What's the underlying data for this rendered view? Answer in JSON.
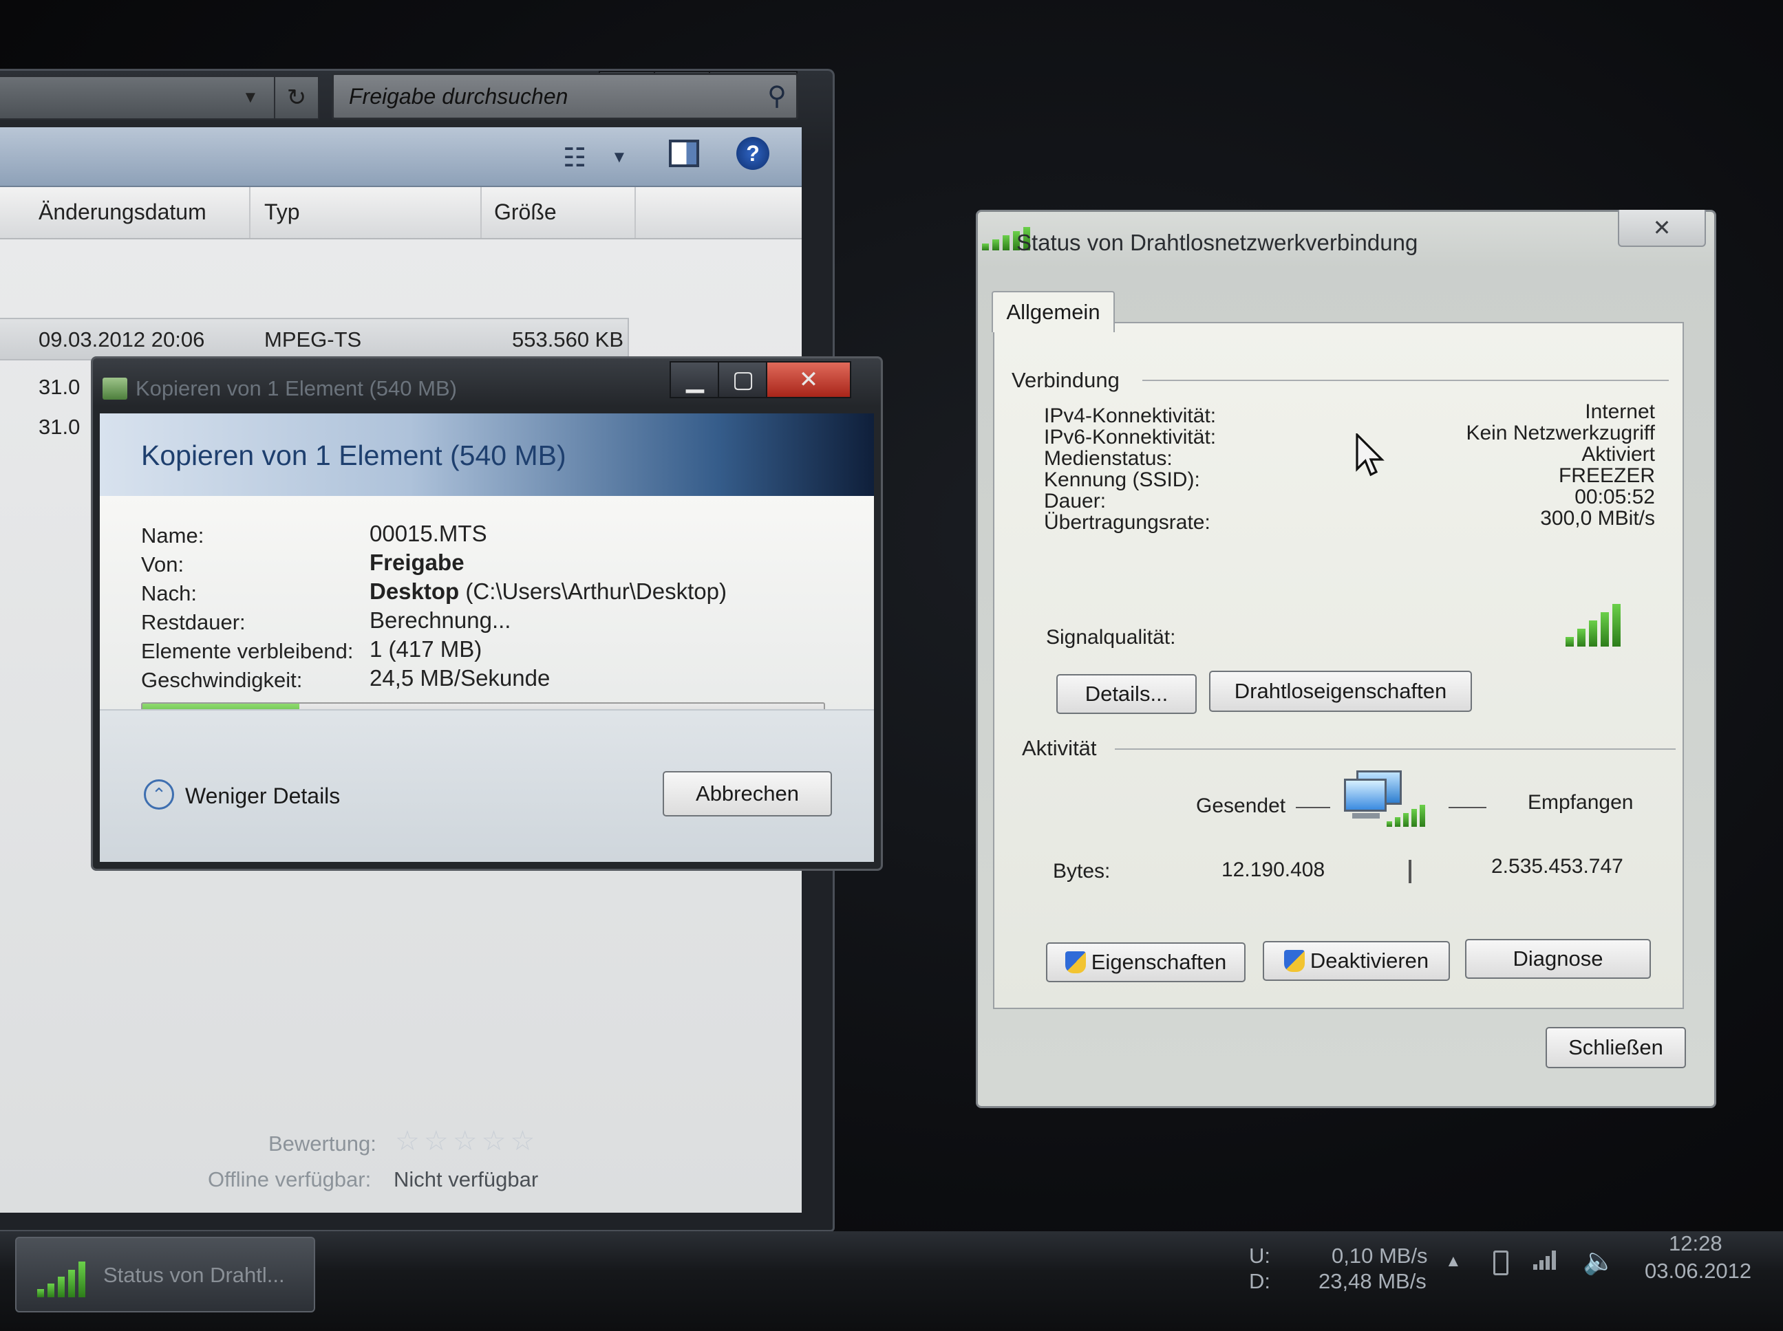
{
  "explorer": {
    "search_placeholder": "Freigabe durchsuchen",
    "columns": [
      "Änderungsdatum",
      "Typ",
      "Größe"
    ],
    "rows": [
      {
        "date": "09.03.2012 20:06",
        "type": "MPEG-TS",
        "size": "553.560 KB"
      },
      {
        "date": "31.0",
        "type": "",
        "size": ""
      },
      {
        "date": "31.0",
        "type": "",
        "size": ""
      }
    ],
    "details": {
      "rating_label": "Bewertung:",
      "rating_stars": 0,
      "offline_label": "Offline verfügbar:",
      "offline_value": "Nicht verfügbar"
    }
  },
  "copy_dialog": {
    "title": "Kopieren von 1 Element (540 MB)",
    "heading": "Kopieren von 1 Element (540 MB)",
    "fields": [
      {
        "label": "Name:",
        "value": "00015.MTS",
        "bold": ""
      },
      {
        "label": "Von:",
        "value": "",
        "bold": "Freigabe"
      },
      {
        "label": "Nach:",
        "value": " (C:\\Users\\Arthur\\Desktop)",
        "bold": "Desktop"
      },
      {
        "label": "Restdauer:",
        "value": "Berechnung...",
        "bold": ""
      },
      {
        "label": "Elemente verbleibend:",
        "value": "1 (417 MB)",
        "bold": ""
      },
      {
        "label": "Geschwindigkeit:",
        "value": "24,5 MB/Sekunde",
        "bold": ""
      }
    ],
    "progress": 0.23,
    "less_details": "Weniger Details",
    "cancel": "Abbrechen"
  },
  "wifi_dialog": {
    "title": "Status von Drahtlosnetzwerkverbindung",
    "tab": "Allgemein",
    "connection_group": "Verbindung",
    "rows": [
      {
        "label": "IPv4-Konnektivität:",
        "value": "Internet"
      },
      {
        "label": "IPv6-Konnektivität:",
        "value": "Kein Netzwerkzugriff"
      },
      {
        "label": "Medienstatus:",
        "value": "Aktiviert"
      },
      {
        "label": "Kennung (SSID):",
        "value": "FREEZER"
      },
      {
        "label": "Dauer:",
        "value": "00:05:52"
      },
      {
        "label": "Übertragungsrate:",
        "value": "300,0 MBit/s"
      }
    ],
    "signal_label": "Signalqualität:",
    "signal_bars": 5,
    "details_btn": "Details...",
    "wireless_props_btn": "Drahtloseigenschaften",
    "activity_group": "Aktivität",
    "sent_label": "Gesendet",
    "received_label": "Empfangen",
    "bytes_label": "Bytes:",
    "bytes_sent": "12.190.408",
    "bytes_received": "2.535.453.747",
    "properties_btn": "Eigenschaften",
    "disable_btn": "Deaktivieren",
    "diagnose_btn": "Diagnose",
    "close_btn": "Schließen"
  },
  "taskbar": {
    "item_label": "Status von Drahtl...",
    "upload_label": "U:",
    "download_label": "D:",
    "upload_rate": "0,10 MB/s",
    "download_rate": "23,48 MB/s",
    "time": "12:28",
    "date": "03.06.2012"
  },
  "colors": {
    "progress_fill": "#3fa332",
    "signal_green": "#4fb735"
  }
}
